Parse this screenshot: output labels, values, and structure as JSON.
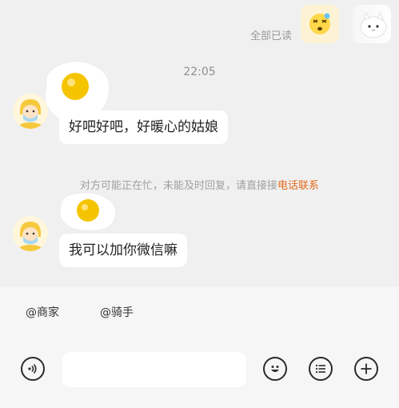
{
  "header": {
    "read_status": "全部已读",
    "sticker_a_icon": "dizzy-face-emoji-icon",
    "sticker_b_icon": "white-cat-sticker-icon"
  },
  "conversation": {
    "timestamp": "22:05",
    "messages": [
      {
        "text": "好吧好吧，好暖心的姑娘",
        "avatar_icon": "rider-avatar-icon",
        "decoration": "fried-egg-sticker-icon"
      },
      {
        "text": "我可以加你微信嘛",
        "avatar_icon": "rider-avatar-icon",
        "decoration": "fried-egg-sticker-icon"
      }
    ],
    "system_notice": {
      "text": "对方可能正在忙，未能及时回复，请直接接",
      "link": "电话联系"
    }
  },
  "quick_bar": {
    "chips": [
      "@商家",
      "@骑手"
    ]
  },
  "input_bar": {
    "placeholder": "",
    "icons": [
      "voice-icon",
      "emoji-icon",
      "quick-phrase-icon",
      "plus-icon"
    ]
  },
  "colors": {
    "background": "#f0f0f0",
    "bubble": "#ffffff",
    "link": "#e26a1b",
    "muted_text": "#9a9a9a",
    "avatar_yellow": "#f6c93d",
    "egg_yolk": "#f5c400"
  }
}
